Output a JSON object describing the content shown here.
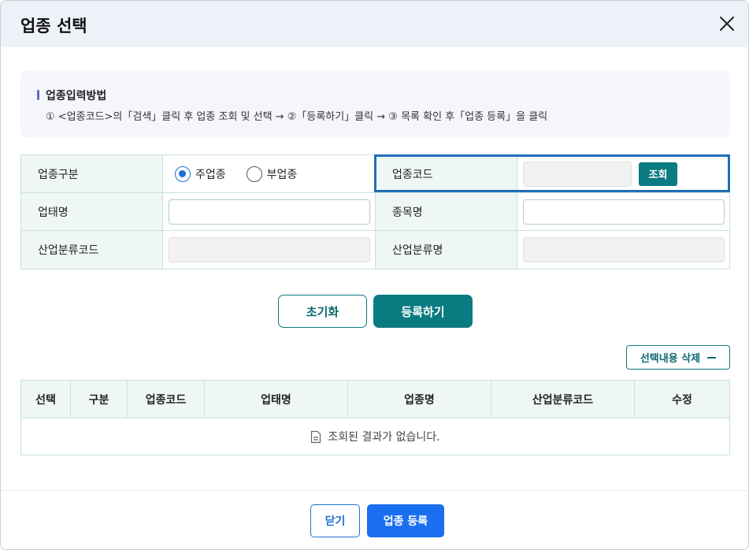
{
  "modal": {
    "title": "업종 선택",
    "close_icon": "close-icon"
  },
  "guide": {
    "title": "업종입력방법",
    "text": "① <업종코드>의「검색」클릭 후 업종 조회 및 선택 → ②「등록하기」클릭 → ③ 목록 확인 후「업종 등록」을 클릭"
  },
  "form": {
    "type_label": "업종구분",
    "radio_main": "주업종",
    "radio_sub": "부업종",
    "selected": "주업종",
    "code_label": "업종코드",
    "code_value": "",
    "search_button": "조회",
    "business_label": "업태명",
    "business_value": "",
    "item_label": "종목명",
    "item_value": "",
    "industry_code_label": "산업분류코드",
    "industry_code_value": "",
    "industry_name_label": "산업분류명",
    "industry_name_value": ""
  },
  "actions": {
    "reset": "초기화",
    "register": "등록하기",
    "delete_selected": "선택내용 삭제"
  },
  "result_table": {
    "columns": [
      "선택",
      "구분",
      "업종코드",
      "업태명",
      "업종명",
      "산업분류코드",
      "수정"
    ],
    "empty_message": "조회된 결과가 없습니다."
  },
  "footer": {
    "close": "닫기",
    "submit": "업종 등록"
  },
  "colors": {
    "accent_teal": "#0b7b82",
    "accent_blue": "#1a6ef0",
    "highlight_border": "#1f6fb5",
    "header_bg": "#eef2f8"
  }
}
